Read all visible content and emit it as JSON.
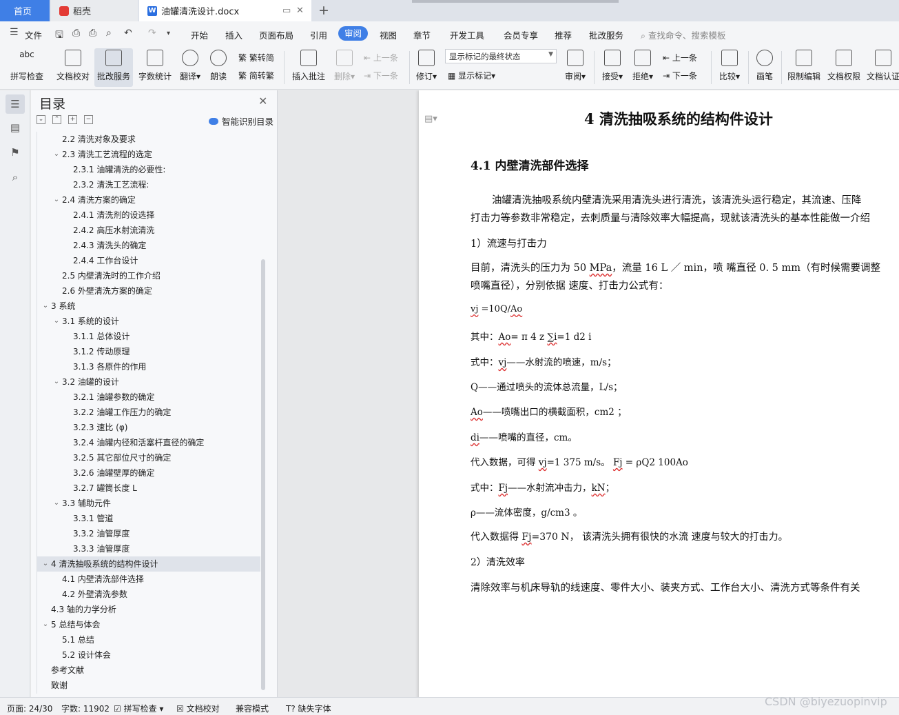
{
  "tabs": {
    "home": "首页",
    "docer": "稻壳",
    "doc": "油罐清洗设计.docx",
    "add": "+",
    "close": "✕"
  },
  "menu": {
    "file": "文件",
    "items": [
      "开始",
      "插入",
      "页面布局",
      "引用",
      "审阅",
      "视图",
      "章节",
      "开发工具",
      "会员专享",
      "推荐",
      "批改服务"
    ],
    "active": "审阅",
    "search": "查找命令、搜索模板"
  },
  "ribbon": {
    "spell_check": "拼写检查",
    "doc_proof": "文档校对",
    "grading": "批改服务",
    "word_count": "字数统计",
    "translate": "翻译",
    "read_aloud": "朗读",
    "trad": "繁转简",
    "simp": "简转繁",
    "insert_comment": "插入批注",
    "delete": "删除",
    "prev": "上一条",
    "next": "下一条",
    "track": "修订",
    "markup_state": "显示标记的最终状态",
    "show_markup": "显示标记",
    "review": "审阅",
    "accept": "接受",
    "reject": "拒绝",
    "prev2": "上一条",
    "next2": "下一条",
    "compare": "比较",
    "pen": "画笔",
    "restrict": "限制编辑",
    "permission": "文档权限",
    "certify": "文档认证"
  },
  "toc": {
    "title": "目录",
    "smart": "智能识别目录",
    "items": [
      {
        "text": "2.2 清洗对象及要求",
        "level": 2,
        "arrow": ""
      },
      {
        "text": "2.3 清洗工艺流程的选定",
        "level": 2,
        "arrow": "v"
      },
      {
        "text": "2.3.1 油罐清洗的必要性:",
        "level": 3,
        "arrow": ""
      },
      {
        "text": "2.3.2 清洗工艺流程:",
        "level": 3,
        "arrow": ""
      },
      {
        "text": "2.4 清洗方案的确定",
        "level": 2,
        "arrow": "v"
      },
      {
        "text": "2.4.1 清洗剂的设选择",
        "level": 3,
        "arrow": ""
      },
      {
        "text": "2.4.2 高压水射流清洗",
        "level": 3,
        "arrow": ""
      },
      {
        "text": "2.4.3 清洗头的确定",
        "level": 3,
        "arrow": ""
      },
      {
        "text": "2.4.4 工作台设计",
        "level": 3,
        "arrow": ""
      },
      {
        "text": "2.5  内壁清洗时的工作介绍",
        "level": 2,
        "arrow": ""
      },
      {
        "text": "2.6  外壁清洗方案的确定",
        "level": 2,
        "arrow": ""
      },
      {
        "text": "3  系统",
        "level": 1,
        "arrow": "v"
      },
      {
        "text": "3.1 系统的设计",
        "level": 2,
        "arrow": "v"
      },
      {
        "text": "3.1.1 总体设计",
        "level": 3,
        "arrow": ""
      },
      {
        "text": "3.1.2 传动原理",
        "level": 3,
        "arrow": ""
      },
      {
        "text": "3.1.3 各原件的作用",
        "level": 3,
        "arrow": ""
      },
      {
        "text": "3.2 油罐的设计",
        "level": 2,
        "arrow": "v"
      },
      {
        "text": "3.2.1 油罐参数的确定",
        "level": 3,
        "arrow": ""
      },
      {
        "text": "3.2.2 油罐工作压力的确定",
        "level": 3,
        "arrow": ""
      },
      {
        "text": "3.2.3    速比  (φ)",
        "level": 3,
        "arrow": ""
      },
      {
        "text": "3.2.4  油罐内径和活塞杆直径的确定",
        "level": 3,
        "arrow": ""
      },
      {
        "text": "3.2.5 其它部位尺寸的确定",
        "level": 3,
        "arrow": ""
      },
      {
        "text": "3.2.6 油罐壁厚的确定",
        "level": 3,
        "arrow": ""
      },
      {
        "text": "3.2.7    罐筒长度 L",
        "level": 3,
        "arrow": ""
      },
      {
        "text": "3.3 辅助元件",
        "level": 2,
        "arrow": "v"
      },
      {
        "text": "3.3.1 管道",
        "level": 3,
        "arrow": ""
      },
      {
        "text": "3.3.2 油管厚度",
        "level": 3,
        "arrow": ""
      },
      {
        "text": "3.3.3 油管厚度",
        "level": 3,
        "arrow": ""
      },
      {
        "text": "4  清洗抽吸系统的结构件设计",
        "level": 1,
        "arrow": "v",
        "active": true
      },
      {
        "text": "4.1 内壁清洗部件选择",
        "level": 2,
        "arrow": ""
      },
      {
        "text": "4.2 外壁清洗参数",
        "level": 2,
        "arrow": ""
      },
      {
        "text": "4.3 轴的力学分析",
        "level": 1.5,
        "arrow": ""
      },
      {
        "text": "5  总结与体会",
        "level": 1,
        "arrow": "v"
      },
      {
        "text": "5.1 总结",
        "level": 2,
        "arrow": ""
      },
      {
        "text": "5.2 设计体会",
        "level": 2,
        "arrow": ""
      },
      {
        "text": "参考文献",
        "level": 1.5,
        "arrow": ""
      },
      {
        "text": "致谢",
        "level": 1.5,
        "arrow": ""
      }
    ]
  },
  "doc": {
    "h1": "4  清洗抽吸系统的结构件设计",
    "h2": "4.1 内壁清洗部件选择",
    "p1": "油罐清洗抽吸系统内壁清洗采用清洗头进行清洗，该清洗头运行稳定，其流速、压降",
    "p2": "打击力等参数非常稳定，去刺质量与清除效率大幅提高，现就该清洗头的基本性能做一介绍",
    "p3": "1）流速与打击力",
    "p4a": "目前，清洗头的压力为 50 ",
    "p4b": "MPa",
    "p4c": "，流量 16 L ／ min，喷 嘴直径 0. 5 mm（有时候需要调整",
    "p5": "喷嘴直径），分别依据 速度、打击力公式有：",
    "p6a": "vj",
    "p6b": " =10Q/",
    "p6c": "Ao",
    "p7a": "其中：",
    "p7b": "Ao",
    "p7c": "= π 4 z ",
    "p7d": "∑i",
    "p7e": "=1 d2 i",
    "p8a": "式中：",
    "p8b": "vj",
    "p8c": "——水射流的喷速，m/s；",
    "p9": "Q——通过喷头的流体总流量，L/s；",
    "p10a": "Ao",
    "p10b": "——喷嘴出口的横截面积，cm2 ；",
    "p11a": "di",
    "p11b": "——喷嘴的直径，cm。",
    "p12a": "代入数据，可得 ",
    "p12b": "vj",
    "p12c": "=1 375 m/s。 ",
    "p12d": "Fj",
    "p12e": " = ρQ2 100Ao",
    "p13a": "式中：",
    "p13b": "Fj",
    "p13c": "——水射流冲击力，",
    "p13d": "kN",
    "p13e": "；",
    "p14": "ρ——流体密度，g/cm3 。",
    "p15a": "代入数据得 ",
    "p15b": "Fj",
    "p15c": "=370 N， 该清洗头拥有很快的水流 速度与较大的打击力。",
    "p16": "2）清洗效率",
    "p17": "清除效率与机床导轨的线速度、零件大小、装夹方式、工作台大小、清洗方式等条件有关"
  },
  "status": {
    "page": "页面: 24/30",
    "words": "字数: 11902",
    "spell": "拼写检查",
    "proof": "文档校对",
    "compat": "兼容模式",
    "missing_font": "缺失字体"
  },
  "watermark": "CSDN @biyezuopinvip",
  "colors": {
    "accent": "#3f7fe6",
    "tabbar": "#dfe3ea",
    "ribbon": "#f4f5f7"
  }
}
